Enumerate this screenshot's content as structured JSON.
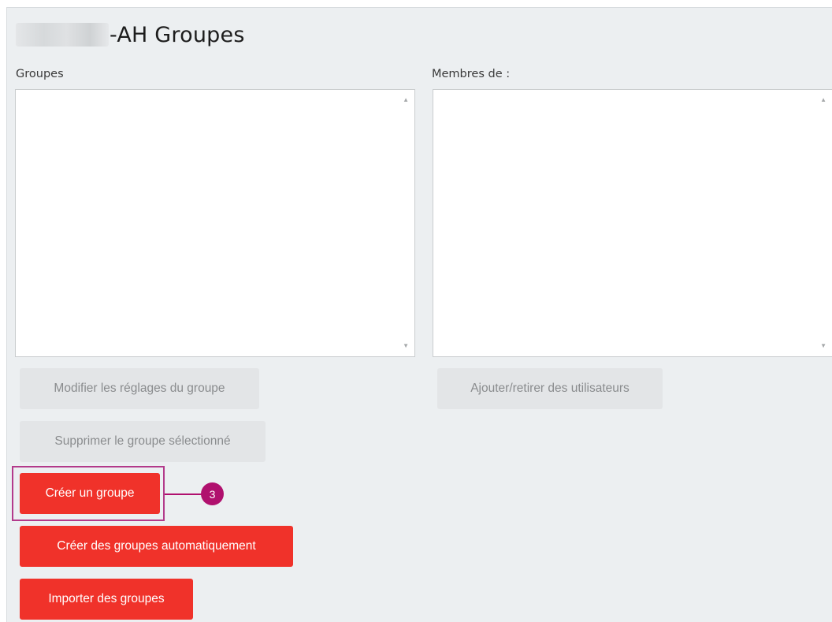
{
  "header": {
    "title": "-AH Groupes"
  },
  "groups_column": {
    "label": "Groupes"
  },
  "members_column": {
    "label": "Membres de :"
  },
  "buttons": {
    "edit_group": "Modifier les réglages du groupe",
    "delete_group": "Supprimer le groupe sélectionné",
    "create_group": "Créer un groupe",
    "auto_create": "Créer des groupes automatiquement",
    "import_groups": "Importer des groupes",
    "add_remove_users": "Ajouter/retirer des utilisateurs"
  },
  "callout": {
    "step_number": "3",
    "color": "#b0106e"
  },
  "colors": {
    "primary_button": "#f0322a",
    "disabled_button": "#e3e5e7",
    "panel_background": "#eceff1"
  },
  "icons": {
    "scroll_up": "▲",
    "scroll_down": "▼"
  }
}
